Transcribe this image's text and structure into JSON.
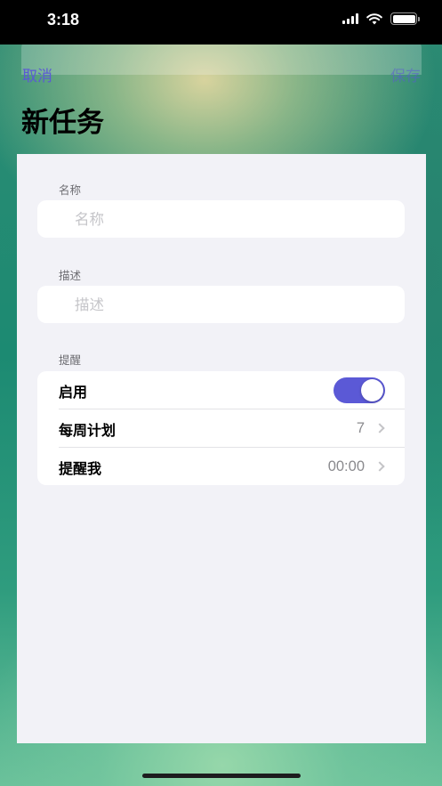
{
  "status": {
    "time": "3:18"
  },
  "nav": {
    "cancel_label": "取消",
    "save_label": "保存",
    "title": "新任务"
  },
  "form": {
    "name": {
      "header": "名称",
      "placeholder": "名称",
      "value": ""
    },
    "description": {
      "header": "描述",
      "placeholder": "描述",
      "value": ""
    },
    "reminder": {
      "header": "提醒",
      "enable_label": "启用",
      "enabled": true,
      "weekly_label": "每周计划",
      "weekly_value": "7",
      "remind_label": "提醒我",
      "remind_value": "00:00"
    }
  },
  "colors": {
    "accent": "#5b59d6",
    "grouped_background": "#f2f2f7",
    "placeholder": "#c5c5c9"
  }
}
